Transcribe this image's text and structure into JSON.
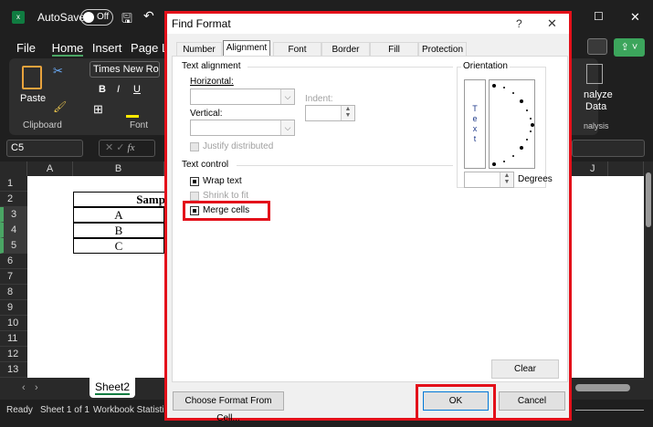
{
  "titlebar": {
    "autosave": "AutoSave",
    "toggle": "Off"
  },
  "menu": [
    "File",
    "Home",
    "Insert",
    "Page Layo"
  ],
  "ribbon": {
    "font_name": "Times New Ro",
    "paste": "Paste",
    "clipboard": "Clipboard",
    "font": "Font",
    "analyze": "nalyze",
    "data": "Data",
    "analysis": "nalysis"
  },
  "formula": {
    "name_box": "C5",
    "fx": "fx"
  },
  "columns": [
    "A",
    "B",
    "J"
  ],
  "rows": [
    "1",
    "2",
    "3",
    "4",
    "5",
    "6",
    "7",
    "8",
    "9",
    "10",
    "11",
    "12",
    "13"
  ],
  "cells": {
    "b2": "Samp",
    "b3": "A",
    "b4": "B",
    "b5": "C"
  },
  "sheet_tab": "Sheet2",
  "status": {
    "ready": "Ready",
    "sheet": "Sheet 1 of 1",
    "stats": "Workbook Statistics"
  },
  "dialog": {
    "title": "Find Format",
    "help": "?",
    "close": "✕",
    "tabs": [
      "Number",
      "Alignment",
      "Font",
      "Border",
      "Fill",
      "Protection"
    ],
    "text_alignment": "Text alignment",
    "horizontal": "Horizontal:",
    "vertical": "Vertical:",
    "indent": "Indent:",
    "justify": "Justify distributed",
    "text_control": "Text control",
    "wrap": "Wrap text",
    "shrink": "Shrink to fit",
    "merge": "Merge cells",
    "orientation": "Orientation",
    "text_vertical": "T e x t",
    "degrees": "Degrees",
    "clear": "Clear",
    "choose": "Choose Format From Cell...",
    "ok": "OK",
    "cancel": "Cancel"
  }
}
